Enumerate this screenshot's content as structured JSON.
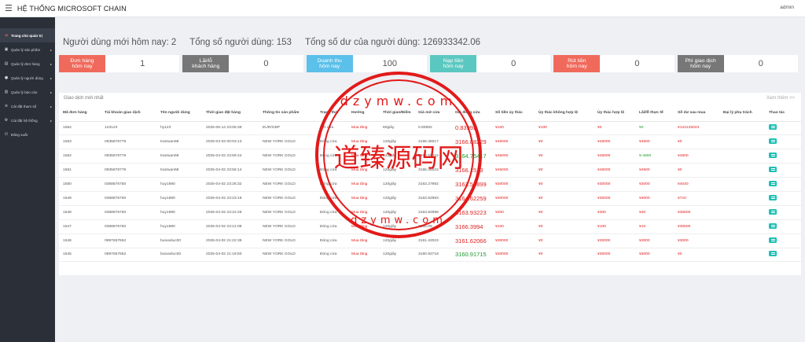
{
  "app": {
    "title": "HỆ THỐNG MICROSOFT CHAIN",
    "user": "admin"
  },
  "sidebar": {
    "items": [
      {
        "label": "Trang chủ quản trị",
        "icon": "home-icon",
        "glyph": "⌂",
        "active": true,
        "arrow": ""
      },
      {
        "label": "Quản lý sản phẩm",
        "icon": "box-icon",
        "glyph": "▣",
        "active": false,
        "arrow": "▸"
      },
      {
        "label": "Quản lý đơn hàng",
        "icon": "cart-icon",
        "glyph": "▤",
        "active": false,
        "arrow": "▸"
      },
      {
        "label": "Quản lý người dùng",
        "icon": "user-icon",
        "glyph": "●",
        "active": false,
        "arrow": "▸"
      },
      {
        "label": "Quản lý báo cáo",
        "icon": "report-icon",
        "glyph": "▥",
        "active": false,
        "arrow": "▸"
      },
      {
        "label": "Cài đặt tham số",
        "icon": "sliders-icon",
        "glyph": "≡",
        "active": false,
        "arrow": "▸"
      },
      {
        "label": "Cài đặt hệ thống",
        "icon": "gear-icon",
        "glyph": "⚙",
        "active": false,
        "arrow": "▸"
      },
      {
        "label": "Đăng xuất",
        "icon": "logout-icon",
        "glyph": "⏻",
        "active": false,
        "arrow": ""
      }
    ]
  },
  "stats": {
    "new_users": "Người dùng mới hôm nay: 2",
    "total_users": "Tổng số người dùng: 153",
    "total_balance": "Tổng số dư của người dùng: 126933342.06"
  },
  "cards": [
    {
      "label": "Đơn hàng\nhôm nay",
      "value": "1",
      "color": "#f06a5c"
    },
    {
      "label": "Lãi/lỗ\nkhách hàng",
      "value": "0",
      "color": "#777777"
    },
    {
      "label": "Doanh thu\nhôm nay",
      "value": "100",
      "color": "#5bc0ea"
    },
    {
      "label": "Nạp tiền\nhôm nay",
      "value": "0",
      "color": "#5ac8c0"
    },
    {
      "label": "Rút tiền\nhôm nay",
      "value": "0",
      "color": "#f06a5c"
    },
    {
      "label": "Phí giao dịch\nhôm nay",
      "value": "0",
      "color": "#777777"
    }
  ],
  "orders": {
    "title": "Giao dịch mới nhất",
    "more": "Xem thêm >>",
    "columns": [
      "Mã đơn hàng",
      "Tài khoản giao dịch",
      "Tên người dùng",
      "Thời gian đặt hàng",
      "Thông tin sản phẩm",
      "Trạng thái",
      "Hướng",
      "Thời gian/Điểm",
      "Giá mở cửa",
      "Giá đóng cửa",
      "Số tiền ủy thác",
      "Ủy thác không hợp lệ",
      "Ủy thác hợp lệ",
      "Lãi/lỗ thực tế",
      "Số dư sau mua",
      "Đại lý phụ trách",
      "Thao tác"
    ],
    "rows": [
      [
        "1554",
        "123123",
        "hy123",
        "2025-06-14 23:05:39",
        "EUR/GBP",
        "Mở cửa",
        "Mua tăng",
        "60giây",
        "0.83992",
        "0.83992",
        "¥100",
        "¥100",
        "¥0",
        "¥0",
        "¥123125023",
        ""
      ],
      [
        "1553",
        "0935878778",
        "trantuan68",
        "2025-04-03 00:03:13",
        "NEW YORK GOLD",
        "Đóng cửa",
        "Mua tăng",
        "120giây",
        "3166.36017",
        "3166.88229",
        "¥46000",
        "¥0",
        "¥46000",
        "¥4600",
        "¥0",
        ""
      ],
      [
        "1552",
        "0935878778",
        "trantuan68",
        "2025-04-02 23:59:44",
        "NEW YORK GOLD",
        "Đóng cửa",
        "Mua tăng",
        "120giây",
        "3165.55015",
        "3164.75417",
        "¥46000",
        "¥0",
        "¥46000",
        "¥-4600",
        "¥4600",
        ""
      ],
      [
        "1551",
        "0935878778",
        "trantuan68",
        "2025-04-02 23:56:14",
        "NEW YORK GOLD",
        "Đóng cửa",
        "Mua tăng",
        "120giây",
        "3165.46015",
        "3166.1513",
        "¥46000",
        "¥0",
        "¥46000",
        "¥4600",
        "¥0",
        ""
      ],
      [
        "1550",
        "0368876750",
        "huy1980",
        "2025-04-02 23:28:32",
        "NEW YORK GOLD",
        "Đóng cửa",
        "Mua tăng",
        "120giây",
        "3163.27892",
        "3163.53899",
        "¥30000",
        "¥0",
        "¥30000",
        "¥3000",
        "¥4040",
        ""
      ],
      [
        "1549",
        "0368876750",
        "huy1980",
        "2025-04-02 23:23:18",
        "NEW YORK GOLD",
        "Đóng cửa",
        "Mua tăng",
        "120giây",
        "3163.92983",
        "3164.62259",
        "¥30000",
        "¥0",
        "¥30000",
        "¥3000",
        "¥710",
        ""
      ],
      [
        "1548",
        "0368876750",
        "huy1980",
        "2025-04-02 23:22:26",
        "NEW YORK GOLD",
        "Đóng cửa",
        "Mua tăng",
        "120giây",
        "3163.92998",
        "3163.93223",
        "¥300",
        "¥0",
        "¥300",
        "¥30",
        "¥30600",
        ""
      ],
      [
        "1547",
        "0368876750",
        "huy1980",
        "2025-04-02 23:21:08",
        "NEW YORK GOLD",
        "Đóng cửa",
        "Mua tăng",
        "120giây",
        "3166.09",
        "3166.3994",
        "¥100",
        "¥0",
        "¥100",
        "¥10",
        "¥30500",
        ""
      ],
      [
        "1546",
        "0897657652",
        "buivanluc00",
        "2025-04-02 21:22:38",
        "NEW YORK GOLD",
        "Đóng cửa",
        "Mua tăng",
        "120giây",
        "3161.42023",
        "3161.62066",
        "¥30000",
        "¥0",
        "¥30000",
        "¥3000",
        "¥3000",
        ""
      ],
      [
        "1545",
        "0897657652",
        "buivanluc00",
        "2025-04-02 21:19:50",
        "NEW YORK GOLD",
        "Đóng cửa",
        "Mua tăng",
        "120giây",
        "3160.92718",
        "3160.91715",
        "¥30000",
        "¥0",
        "¥30000",
        "¥3000",
        "¥0",
        ""
      ]
    ]
  },
  "watermark": {
    "cn": "道臻源码网",
    "latin": "dzymw.com",
    "color": "#e21a1a"
  }
}
